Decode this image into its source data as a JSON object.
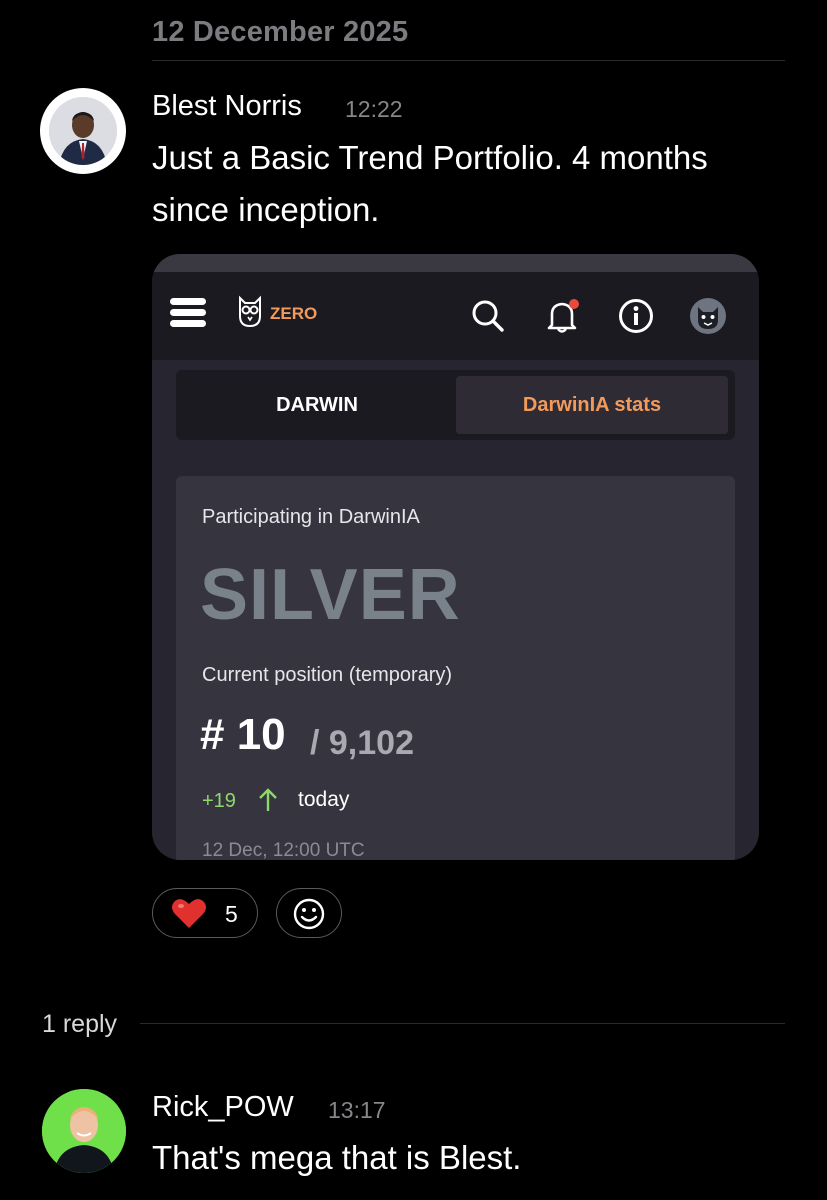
{
  "date_header": "12 December 2025",
  "post": {
    "author": "Blest Norris",
    "time": "12:22",
    "text_lines": [
      "Just a Basic Trend Portfolio. 4 months",
      "since inception."
    ],
    "attachment": {
      "brand": "ZERO",
      "tabs": [
        "DARWIN",
        "DarwinIA stats"
      ],
      "active_tab": "DarwinIA stats",
      "participating": "Participating in DarwinIA",
      "tier": "SILVER",
      "position_label": "Current position (temporary)",
      "rank": "# 10",
      "total": "/ 9,102",
      "delta": "+19",
      "delta_period": "today",
      "updated": "12 Dec, 12:00 UTC",
      "icons": [
        "menu-icon",
        "owl-logo-icon",
        "search-icon",
        "bell-icon",
        "info-icon",
        "avatar-icon"
      ],
      "accent_color": "#f19a5a",
      "positive_color": "#8ed96a"
    },
    "reactions": [
      {
        "emoji": "heart",
        "count": "5"
      },
      {
        "emoji": "add-reaction-icon",
        "count": ""
      }
    ]
  },
  "replies_label": "1 reply",
  "reply": {
    "author": "Rick_POW",
    "time": "13:17",
    "text": "That's mega that is Blest."
  }
}
